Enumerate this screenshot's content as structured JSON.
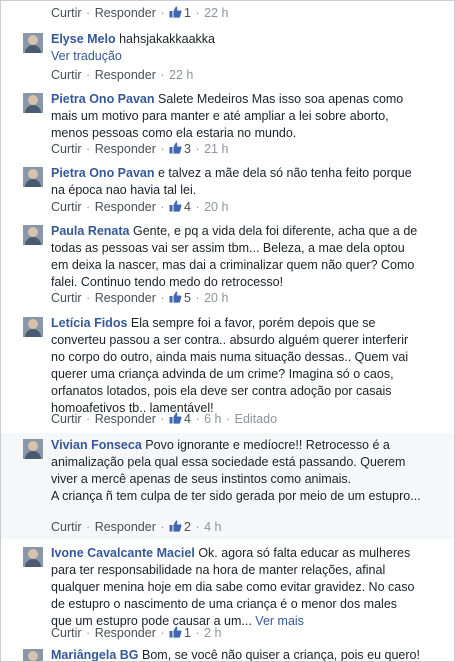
{
  "icons": {
    "like": "thumbs-up-icon",
    "avatar": "user-avatar-icon"
  },
  "colors": {
    "author": "#365899",
    "meta": "#90949c",
    "like_blue": "#4267b2",
    "border": "#c9ccd1"
  },
  "labels": {
    "reply": "Curtir",
    "respond": "Responder",
    "translate": "Ver tradução",
    "see_more": "Ver mais",
    "edited": "Editado",
    "dot": "·"
  },
  "comments": [
    {
      "author": "",
      "text": "",
      "likes": "1",
      "time": "22 h"
    },
    {
      "author": "Elyse Melo",
      "text": "hahsjakakkaakka",
      "time": "22 h"
    },
    {
      "author": "Pietra Ono Pavan",
      "text": "Salete Medeiros Mas isso soa apenas como mais um motivo para manter e até ampliar a lei sobre aborto, menos pessoas como ela estaria no mundo.",
      "likes": "3",
      "time": "21 h"
    },
    {
      "author": "Pietra Ono Pavan",
      "text": "e talvez a mãe dela só não tenha feito porque na época nao havia tal lei.",
      "likes": "4",
      "time": "20 h"
    },
    {
      "author": "Paula Renata",
      "text": "Gente, e pq a vida dela foi diferente, acha que a de todas as pessoas vai ser assim tbm... Beleza, a mae dela optou em deixa la nascer, mas dai a criminalizar quem não quer? Como falei. Continuo tendo medo do retrocesso!",
      "likes": "5",
      "time": "20 h"
    },
    {
      "author": "Letícia Fidos",
      "text": "Ela sempre foi a favor, porém depois que se converteu passou a ser contra.. absurdo alguém querer interferir no corpo do outro, ainda mais numa situação dessas.. Quem vai querer uma criança advinda de um crime? Imagina só o caos, orfanatos lotados, pois ela deve ser contra adoção por casais homoafetivos tb.. lamentável!",
      "likes": "4",
      "time": "6 h"
    },
    {
      "author": "Vivian Fonseca",
      "text": "Povo ignorante e medíocre!! Retrocesso é a animalização pela qual essa sociedade está passando. Querem viver a mercê apenas de seus instintos como animais.",
      "text2": "A criança ñ tem culpa de ter sido gerada por meio de um estupro...",
      "likes": "2",
      "time": "4 h"
    },
    {
      "author": "Ivone Cavalcante Maciel",
      "text": "Ok. agora só falta educar as mulheres para ter responsabilidade na hora de manter relações, afinal qualquer menina hoje em dia sabe como evitar gravidez. No caso de estupro o nascimento de uma criança é o menor dos males que um estupro pode causar a um...",
      "likes": "1",
      "time": "2 h"
    },
    {
      "author": "Mariângela BG",
      "text": "Bom, se você não quiser a criança, pois eu quero!"
    }
  ]
}
